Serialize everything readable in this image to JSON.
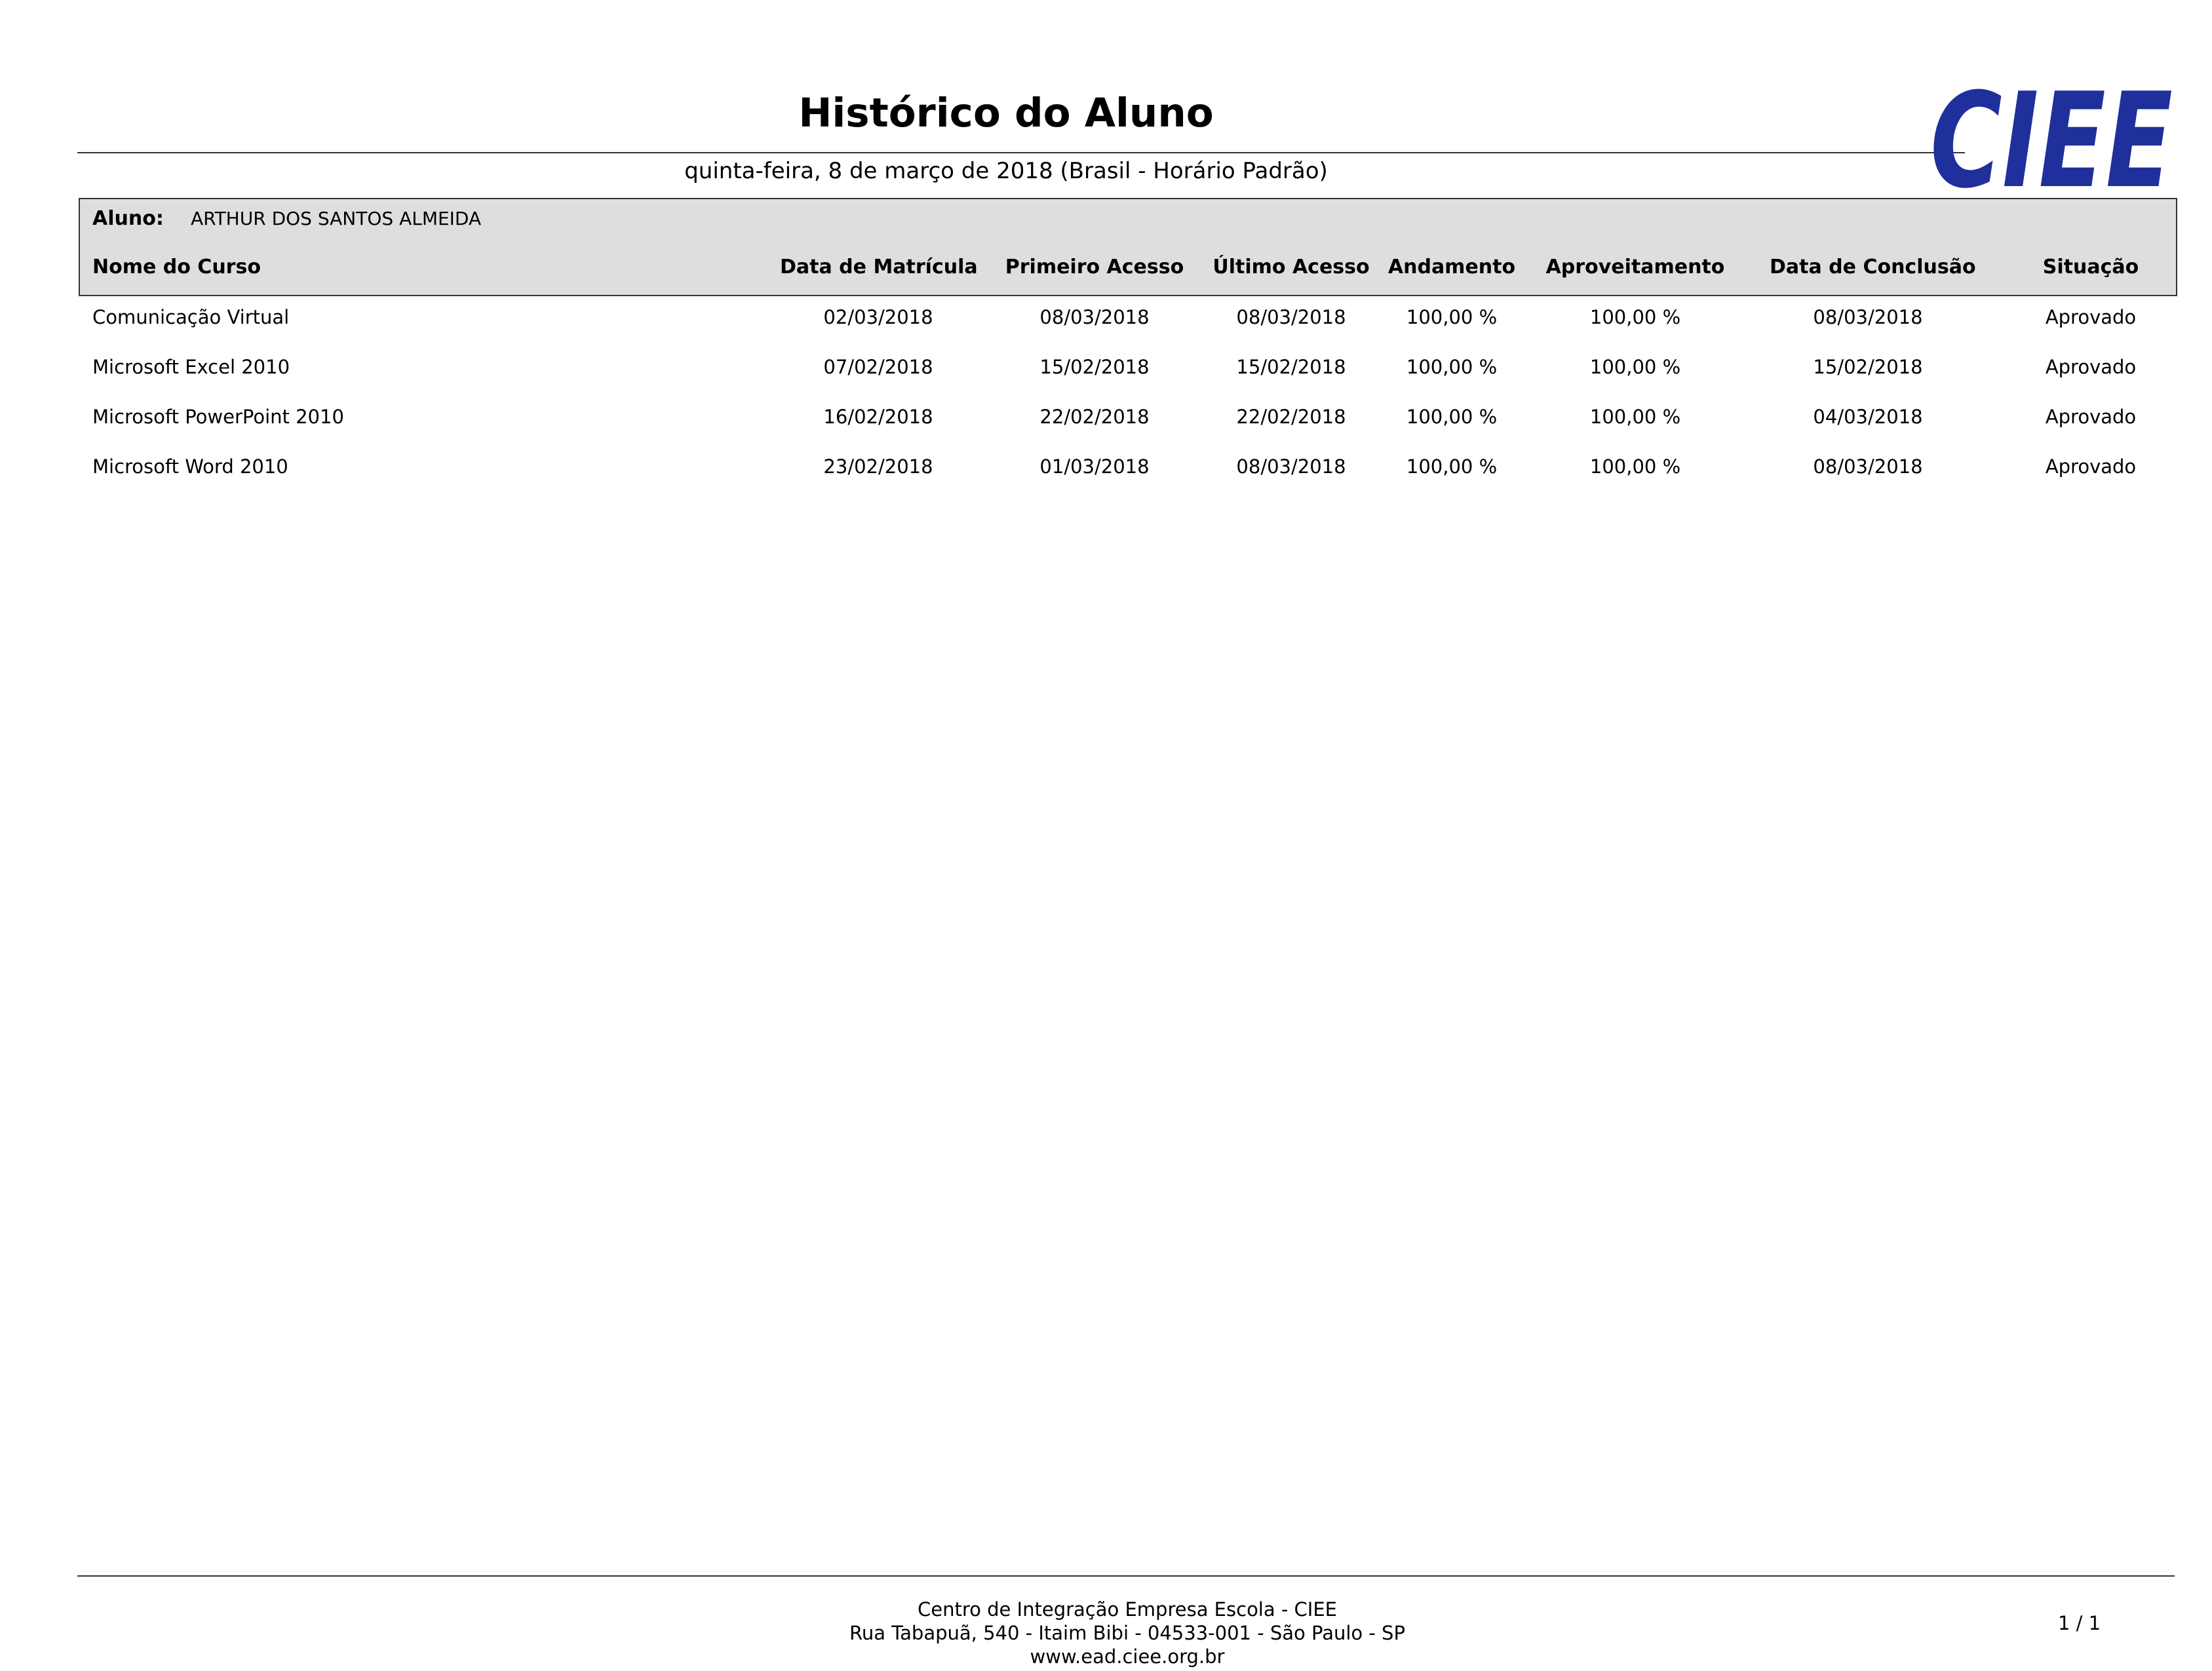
{
  "document": {
    "title": "Histórico do Aluno",
    "date": "quinta-feira, 8 de março de 2018 (Brasil - Horário Padrão)",
    "logo_text": "CIEE",
    "brand_color": "#1f2f9c"
  },
  "student": {
    "label": "Aluno:",
    "name": "ARTHUR DOS SANTOS ALMEIDA"
  },
  "table": {
    "headers": {
      "course": "Nome do Curso",
      "enrollment": "Data de Matrícula",
      "first_access": "Primeiro Acesso",
      "last_access": "Último Acesso",
      "progress": "Andamento",
      "score": "Aproveitamento",
      "completion": "Data de Conclusão",
      "status": "Situação"
    },
    "rows": [
      {
        "course": "Comunicação Virtual",
        "enrollment": "02/03/2018",
        "first_access": "08/03/2018",
        "last_access": "08/03/2018",
        "progress": "100,00 %",
        "score": "100,00 %",
        "completion": "08/03/2018",
        "status": "Aprovado"
      },
      {
        "course": "Microsoft Excel 2010",
        "enrollment": "07/02/2018",
        "first_access": "15/02/2018",
        "last_access": "15/02/2018",
        "progress": "100,00 %",
        "score": "100,00 %",
        "completion": "15/02/2018",
        "status": "Aprovado"
      },
      {
        "course": "Microsoft PowerPoint 2010",
        "enrollment": "16/02/2018",
        "first_access": "22/02/2018",
        "last_access": "22/02/2018",
        "progress": "100,00 %",
        "score": "100,00 %",
        "completion": "04/03/2018",
        "status": "Aprovado"
      },
      {
        "course": "Microsoft Word 2010",
        "enrollment": "23/02/2018",
        "first_access": "01/03/2018",
        "last_access": "08/03/2018",
        "progress": "100,00 %",
        "score": "100,00 %",
        "completion": "08/03/2018",
        "status": "Aprovado"
      }
    ]
  },
  "footer": {
    "line1": "Centro de Integração Empresa Escola - CIEE",
    "line2": "Rua Tabapuã, 540 - Itaim Bibi - 04533-001 - São Paulo - SP",
    "line3": "www.ead.ciee.org.br",
    "page": "1 / 1"
  }
}
